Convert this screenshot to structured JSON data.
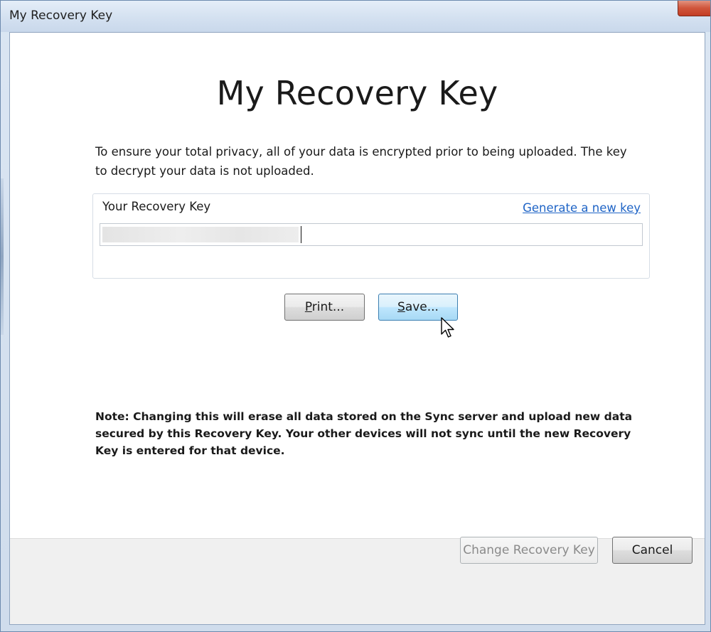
{
  "window": {
    "title": "My Recovery Key"
  },
  "dialog": {
    "heading": "My Recovery Key",
    "privacy_text": "To ensure your total privacy, all of your data is encrypted prior to being uploaded. The key to decrypt your data is not uploaded.",
    "key_group": {
      "label": "Your Recovery Key",
      "generate_link": "Generate a new key",
      "key_value_obscured": true
    },
    "buttons": {
      "print": {
        "mnemonic": "P",
        "rest": "rint..."
      },
      "save": {
        "mnemonic": "S",
        "rest": "ave..."
      }
    },
    "note_text": "Note: Changing this will erase all data stored on the Sync server and upload new data secured by this Recovery Key. Your other devices will not sync until the new Recovery Key is entered for that device."
  },
  "footer": {
    "change_recovery_key_label": "Change Recovery Key",
    "change_recovery_key_enabled": false,
    "cancel_label": "Cancel"
  },
  "colors": {
    "link": "#1f64c6",
    "save_button_border": "#3c7fb1",
    "disabled_text": "#8a8a8a"
  },
  "icons": {
    "cursor": "mouse-pointer-arrow"
  }
}
